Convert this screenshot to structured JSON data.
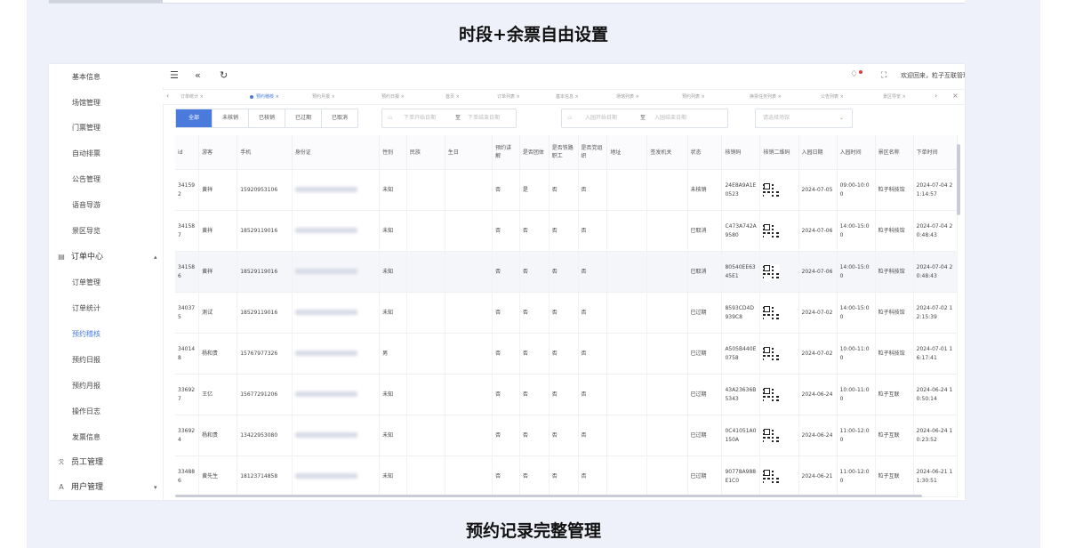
{
  "headings": {
    "top": "时段+余票自由设置",
    "bottom": "预约记录完整管理"
  },
  "sidebar": {
    "items": [
      "基本信息",
      "场馆管理",
      "门票管理",
      "自动排票",
      "公告管理",
      "语音导游",
      "景区导览"
    ],
    "group_order": {
      "label": "订单中心",
      "icon": "▤"
    },
    "order_items": [
      "订单管理",
      "订单统计",
      "预约稽核",
      "预约日报",
      "预约月报",
      "操作日志",
      "发票信息"
    ],
    "active_item": "预约稽核",
    "group_staff": {
      "label": "员工管理",
      "icon": "ℛ"
    },
    "group_user": {
      "label": "用户管理",
      "icon": "A"
    }
  },
  "topbar": {
    "menu_icon": "☰",
    "collapse_icon": "«",
    "refresh_icon": "↻",
    "bell_icon": "🔔",
    "fullscreen_icon": "⛶",
    "welcome": "欢迎回来，粒子互联管理员 ▾"
  },
  "tags": [
    "订单统计",
    "预约稽核",
    "预约月报",
    "预约日报",
    "首页",
    "订单列表",
    "基本信息",
    "场馆列表",
    "预约列表",
    "换票任务列表",
    "公告列表",
    "景区导览"
  ],
  "tag_active": "预约稽核",
  "filters": {
    "segments": [
      "全部",
      "未核销",
      "已核销",
      "已过期",
      "已取消"
    ],
    "segment_active": "全部",
    "order_date_start": "下单开始日期",
    "order_date_sep": "至",
    "order_date_end": "下单结束日期",
    "visit_date_start": "入园开始日期",
    "visit_date_sep": "至",
    "visit_date_end": "入园结束日期",
    "scenic_placeholder": "请选择场馆"
  },
  "table": {
    "columns": [
      "id",
      "游客",
      "手机",
      "身份证",
      "性别",
      "民族",
      "生日",
      "预约讲解",
      "是否团体",
      "是否铁路职工",
      "是否党组织",
      "地址",
      "签发机关",
      "状态",
      "核销码",
      "核销二维码",
      "入园日期",
      "入园时间",
      "景区名称",
      "下单时间"
    ],
    "rows": [
      {
        "id": "341592",
        "name": "黄祥",
        "phone": "15920953106",
        "gender": "未知",
        "guide": "否",
        "group": "是",
        "rail": "否",
        "party": "否",
        "status": "未核销",
        "code": "24E8A9A1E0523",
        "date": "2024-07-05",
        "time": "09:00-10:00",
        "scenic": "粒子科技馆",
        "ordered": "2024-07-04 21:14:57"
      },
      {
        "id": "341587",
        "name": "黄祥",
        "phone": "18529119016",
        "gender": "未知",
        "guide": "否",
        "group": "否",
        "rail": "否",
        "party": "否",
        "status": "已取消",
        "code": "C473A742A9580",
        "date": "2024-07-06",
        "time": "14:00-15:00",
        "scenic": "粒子科技馆",
        "ordered": "2024-07-04 20:48:43"
      },
      {
        "id": "341586",
        "name": "黄祥",
        "phone": "18529119016",
        "gender": "未知",
        "guide": "否",
        "group": "否",
        "rail": "否",
        "party": "否",
        "status": "已取消",
        "code": "80540EE6345E1",
        "date": "2024-07-06",
        "time": "14:00-15:00",
        "scenic": "粒子科技馆",
        "ordered": "2024-07-04 20:48:43"
      },
      {
        "id": "340375",
        "name": "测试",
        "phone": "18529119016",
        "gender": "未知",
        "guide": "否",
        "group": "否",
        "rail": "否",
        "party": "否",
        "status": "已过期",
        "code": "8593CD4D939C8",
        "date": "2024-07-02",
        "time": "14:00-15:00",
        "scenic": "粒子科技馆",
        "ordered": "2024-07-02 12:15:39"
      },
      {
        "id": "340148",
        "name": "杨和贵",
        "phone": "15767977326",
        "gender": "男",
        "guide": "否",
        "group": "否",
        "rail": "否",
        "party": "否",
        "status": "已过期",
        "code": "A505B440E0758",
        "date": "2024-07-02",
        "time": "10:00-11:00",
        "scenic": "粒子科技馆",
        "ordered": "2024-07-01 16:17:41"
      },
      {
        "id": "336927",
        "name": "王亿",
        "phone": "15677291206",
        "gender": "未知",
        "guide": "否",
        "group": "否",
        "rail": "否",
        "party": "否",
        "status": "已过期",
        "code": "43A23636B5343",
        "date": "2024-06-24",
        "time": "10:00-11:00",
        "scenic": "粒子互联",
        "ordered": "2024-06-24 10:50:14"
      },
      {
        "id": "336924",
        "name": "杨和贵",
        "phone": "13422953080",
        "gender": "未知",
        "guide": "否",
        "group": "否",
        "rail": "否",
        "party": "否",
        "status": "已过期",
        "code": "0C41051A0150A",
        "date": "2024-06-24",
        "time": "11:00-12:00",
        "scenic": "粒子互联",
        "ordered": "2024-06-24 10:23:52"
      },
      {
        "id": "334886",
        "name": "黄先生",
        "phone": "18123714858",
        "gender": "未知",
        "guide": "否",
        "group": "否",
        "rail": "否",
        "party": "否",
        "status": "已过期",
        "code": "90778A988E1C0",
        "date": "2024-06-21",
        "time": "11:00-12:00",
        "scenic": "粒子互联",
        "ordered": "2024-06-21 11:30:51"
      }
    ]
  }
}
